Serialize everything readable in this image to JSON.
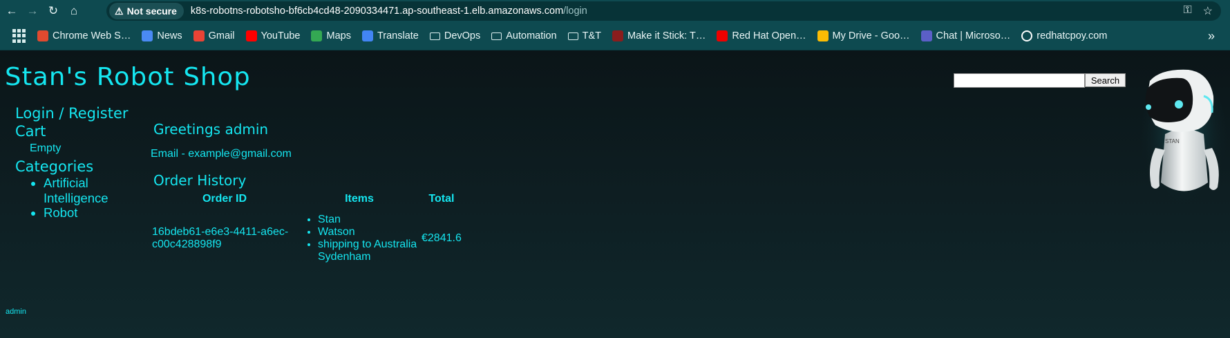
{
  "browser": {
    "security": "Not secure",
    "url_host": "k8s-robotns-robotsho-bf6cb4cd48-2090334471.ap-southeast-1.elb.amazonaws.com",
    "url_path": "/login",
    "bookmarks": [
      {
        "label": "Chrome Web S…",
        "icon": "chrome-web-store-icon",
        "color": "#e04a2f"
      },
      {
        "label": "News",
        "icon": "google-news-icon",
        "color": "#4a8af4"
      },
      {
        "label": "Gmail",
        "icon": "gmail-icon",
        "color": "#ea4335"
      },
      {
        "label": "YouTube",
        "icon": "youtube-icon",
        "color": "#ff0000"
      },
      {
        "label": "Maps",
        "icon": "maps-icon",
        "color": "#34a853"
      },
      {
        "label": "Translate",
        "icon": "translate-icon",
        "color": "#4285f4"
      },
      {
        "label": "DevOps",
        "icon": "folder-icon",
        "color": ""
      },
      {
        "label": "Automation",
        "icon": "folder-icon",
        "color": ""
      },
      {
        "label": "T&T",
        "icon": "folder-icon",
        "color": ""
      },
      {
        "label": "Make it Stick: T…",
        "icon": "make-it-stick-icon",
        "color": "#8a1d1d"
      },
      {
        "label": "Red Hat Open…",
        "icon": "red-hat-icon",
        "color": "#ee0000"
      },
      {
        "label": "My Drive - Goo…",
        "icon": "google-drive-icon",
        "color": "#fbbc04"
      },
      {
        "label": "Chat | Microso…",
        "icon": "teams-icon",
        "color": "#5b5fc7"
      },
      {
        "label": "redhatcpoy.com",
        "icon": "globe-icon",
        "color": "#ffffff"
      }
    ]
  },
  "site": {
    "title": "Stan's Robot Shop",
    "search_button": "Search",
    "accent_color": "#15e6f0"
  },
  "sidebar": {
    "login": "Login / Register",
    "cart": "Cart",
    "cart_status": "Empty",
    "categories_title": "Categories",
    "categories": [
      "Artificial Intelligence",
      "Robot"
    ]
  },
  "account": {
    "greeting": "Greetings admin",
    "email": "Email - example@gmail.com",
    "order_history_title": "Order History",
    "columns": [
      "Order ID",
      "Items",
      "Total"
    ],
    "orders": [
      {
        "id": "16bdeb61-e6e3-4411-a6ec-c00c428898f9",
        "items": [
          "Stan",
          "Watson",
          "shipping to Australia Sydenham"
        ],
        "total": "€2841.6"
      }
    ]
  },
  "footer": {
    "user": "admin"
  }
}
